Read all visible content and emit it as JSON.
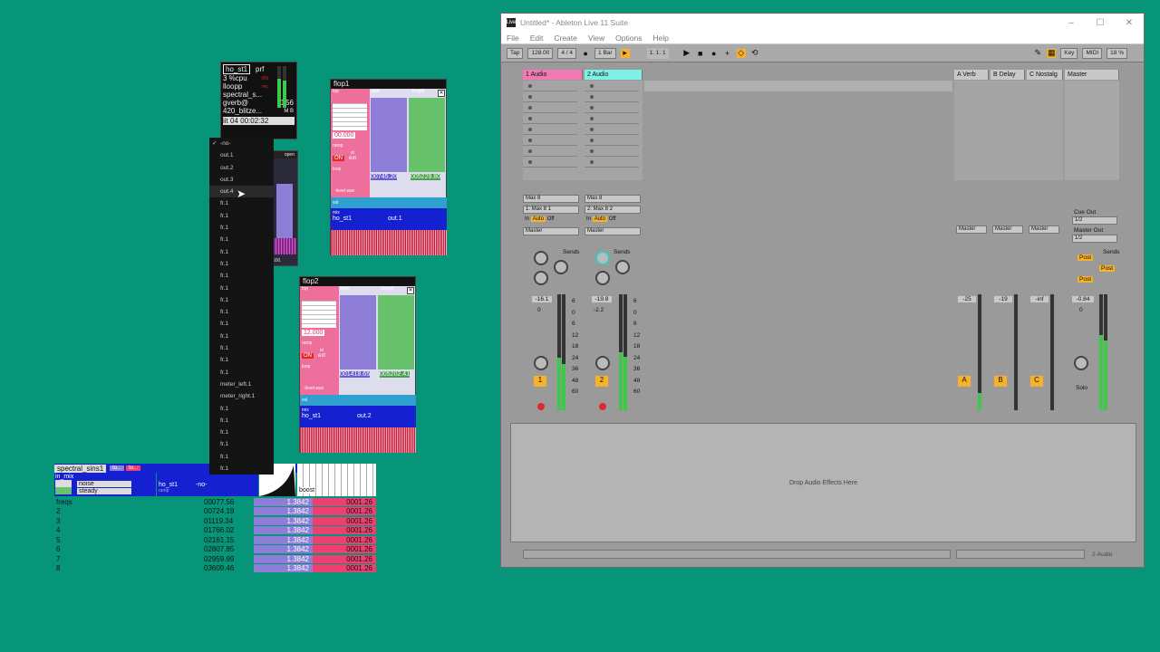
{
  "ableton": {
    "title": "Untitled* - Ableton Live 11 Suite",
    "logo": "Live",
    "window_controls": [
      "–",
      "☐",
      "✕"
    ],
    "menu": [
      "File",
      "Edit",
      "Create",
      "View",
      "Options",
      "Help"
    ],
    "transport": {
      "tap": "Tap",
      "tempo": "128.00",
      "sig": "4 / 4",
      "quant": "1 Bar",
      "pos": "1.   1.   1",
      "key": "Key",
      "midi": "MIDI",
      "cpu": "18 %"
    },
    "tracks": [
      {
        "name": "1 Audio",
        "color": "#f27ab3",
        "input": "Max 8",
        "channel": "1: Max 8 1",
        "out": "Master",
        "vol": "-16.1",
        "pan": "0",
        "num": "1"
      },
      {
        "name": "2 Audio",
        "color": "#7ef1e6",
        "input": "Max 8",
        "channel": "2: Max 8 2",
        "out": "Master",
        "vol": "-19.8",
        "pan": "-2.2",
        "num": "2"
      }
    ],
    "returns": [
      {
        "name": "A Verb",
        "num": "A",
        "vol": "-25"
      },
      {
        "name": "B Delay",
        "num": "B",
        "vol": "-19"
      },
      {
        "name": "C Nostalg",
        "num": "C",
        "vol": "-inf"
      }
    ],
    "master": {
      "name": "Master",
      "vol": "-0.84",
      "pan": "0",
      "cue": "Cue Out",
      "cue_val": "1/2",
      "mout": "Master Out",
      "mout_val": "1/2",
      "solo": "Solo",
      "post": "Post"
    },
    "labels": {
      "sends": "Sends",
      "auto": "Auto",
      "off": "Off",
      "in": "In",
      "inf": "-inf",
      "scale": [
        "6",
        "0",
        "6",
        "12",
        "18",
        "24",
        "36",
        "48",
        "60"
      ]
    },
    "drop": "Drop Audio Effects Here",
    "bottom_tab": "2-Audio"
  },
  "ho_st1": {
    "title": "ho_st1",
    "perf": "prf",
    "cpu": "3 %cpu",
    "cpu_val": "ON",
    "loop": "lloopp",
    "rec": "rec",
    "spec": "spectral_s...",
    "gverb": "gverb@",
    "gverb_val": "0.56",
    "blitz": "420_blitze...",
    "blitz_btns": "M  B",
    "bottom": "iit   04   00:02:32",
    "open": "open",
    "num": "500."
  },
  "menu_items": [
    "-no-",
    "out.1",
    "out.2",
    "out.3",
    "out.4",
    "fr.1",
    "fr.1",
    "fr.1",
    "fr.1",
    "fr.1",
    "fr.1",
    "fr.1",
    "fr.1",
    "fr.1",
    "fr.1",
    "fr.1",
    "fr.1",
    "fr.1",
    "fr.1",
    "fr.1",
    "meter_left.1",
    "meter_right.1",
    "fr.1",
    "fr.1",
    "fr.1",
    "fr.1",
    "fr.1",
    "fr.1"
  ],
  "flop1": {
    "title": "flop1",
    "top": "top",
    "start": "start",
    "length": "length",
    "val": "00.000",
    "ramp": "ramp",
    "st": "st",
    "loop": "loop",
    "on": "ON",
    "ext": "ext",
    "readout1": "00745.20",
    "readout2": "005229.80",
    "file": "-level.wav",
    "vol": "vol",
    "mix": "mix",
    "route": "ho_st1",
    "out": "out.1"
  },
  "flop2": {
    "title": "flop2",
    "top": "top",
    "start": "start",
    "length": "length",
    "val": "12.000",
    "ramp": "ramp",
    "st": "st",
    "loop": "loop",
    "on": "ON",
    "ext": "ext",
    "readout1": "001418.65",
    "readout2": "005202.41",
    "file": "-level.wav",
    "vol": "vol",
    "mix": "mix",
    "route": "ho_st1",
    "out": "out.2"
  },
  "spectral": {
    "title": "spectral_sins1",
    "to": "to...",
    "mix": "in_mix",
    "noise": "noise",
    "steady": "steady",
    "route": "ho_st1",
    "no": "-no-",
    "ramp": "ramp",
    "boost": "boost",
    "freqs": "freqs",
    "rows": [
      {
        "idx": "2",
        "freq": "00724.19",
        "amp": "1.3842",
        "val": "0001.26"
      },
      {
        "idx": "3",
        "freq": "01119.34",
        "amp": "1.3842",
        "val": "0001.26"
      },
      {
        "idx": "4",
        "freq": "01766.02",
        "amp": "1.3842",
        "val": "0001.26"
      },
      {
        "idx": "5",
        "freq": "02161.15",
        "amp": "1.3842",
        "val": "0001.26"
      },
      {
        "idx": "6",
        "freq": "02807.85",
        "amp": "1.3842",
        "val": "0001.26"
      },
      {
        "idx": "7",
        "freq": "02959.99",
        "amp": "1.3842",
        "val": "0001.26"
      },
      {
        "idx": "8",
        "freq": "03609.46",
        "amp": "1.3842",
        "val": "0001.26"
      }
    ],
    "first": {
      "freq": "00077.56",
      "amp": "1.3842",
      "val": "0001.26"
    }
  }
}
